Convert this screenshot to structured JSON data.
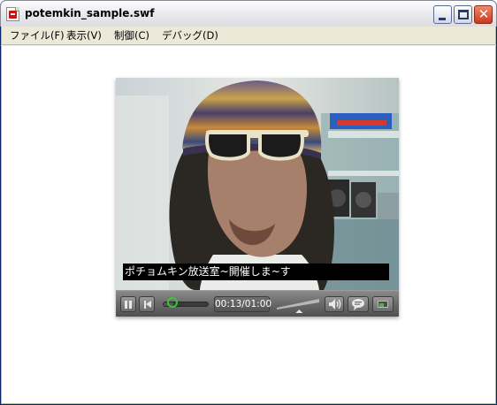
{
  "window": {
    "title": "potemkin_sample.swf",
    "buttons": {
      "minimize": "_",
      "maximize": "",
      "close": "✕"
    }
  },
  "menu": {
    "items": [
      {
        "label": "ファイル(F)"
      },
      {
        "label": "表示(V)"
      },
      {
        "label": "制御(C)"
      },
      {
        "label": "デバッグ(D)"
      }
    ]
  },
  "player": {
    "subtitle": "ポチョムキン放送室~開催しま~す",
    "time": "00:13/01:00",
    "seek_progress": 0.217,
    "volume_level": 0.55,
    "icons": {
      "pause": "pause-icon",
      "rewind": "skip-back-icon",
      "volume": "speaker-icon",
      "caption": "speech-bubble-icon",
      "screen": "screen-icon"
    },
    "accent_color": "#35c635"
  }
}
